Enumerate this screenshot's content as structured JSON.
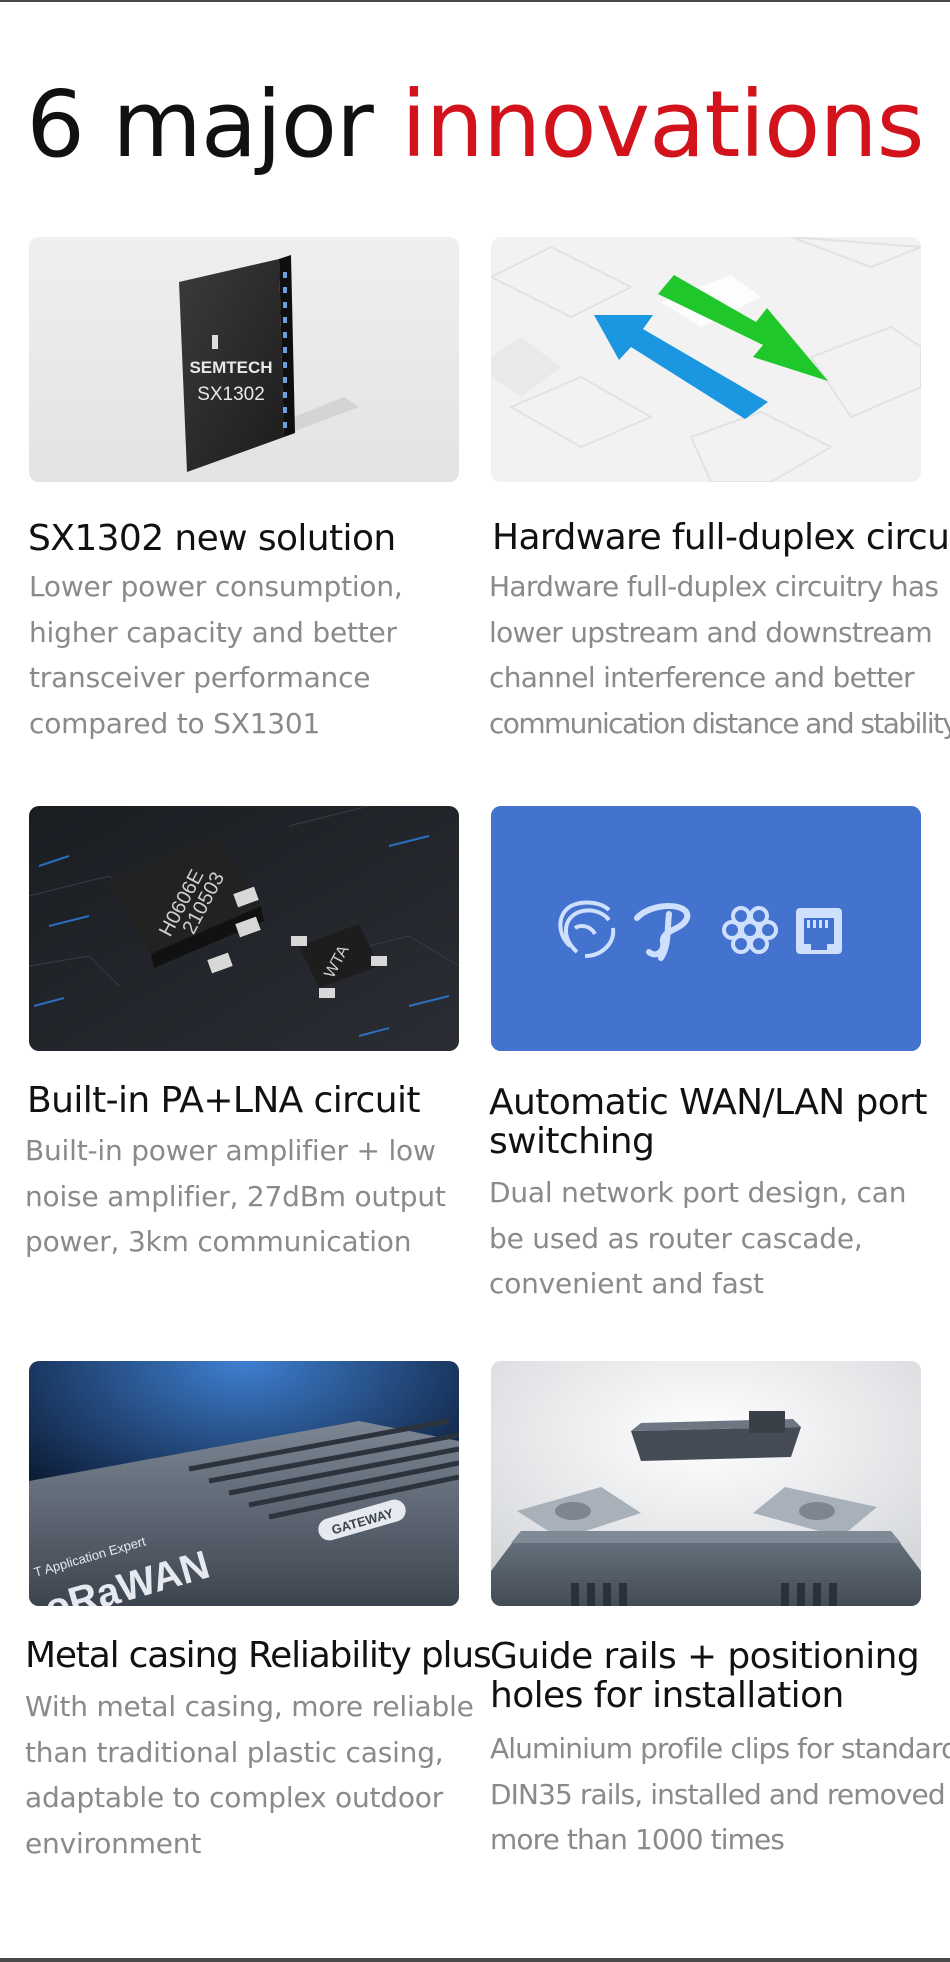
{
  "headline": {
    "part1": "6 major",
    "part2": "innovations"
  },
  "colors": {
    "accent": "#d2131c",
    "title": "#111111",
    "desc": "#8a8a8a",
    "carrier_bg": "#4472cf"
  },
  "features": [
    {
      "title": "SX1302 new solution",
      "desc": [
        "Lower power consumption,",
        "higher capacity and better",
        "transceiver performance",
        "compared to SX1301"
      ],
      "image": {
        "type": "chip-photo",
        "chip_text": [
          "SEMTECH",
          "SX1302"
        ]
      }
    },
    {
      "title": "Hardware full-duplex circuit",
      "desc": [
        "Hardware full-duplex circuitry has",
        "lower upstream and downstream",
        "channel interference and better",
        "communication distance and stability."
      ],
      "image": {
        "type": "duplex-arrows",
        "icons": [
          "arrow-up-left-icon",
          "arrow-down-right-icon"
        ]
      }
    },
    {
      "title": "Built-in PA+LNA circuit",
      "desc": [
        "Built-in power amplifier + low",
        "noise amplifier, 27dBm output",
        "power, 3km communication"
      ],
      "image": {
        "type": "pcb-photo",
        "chip_text": [
          "H0606E",
          "210503",
          "WTA"
        ]
      }
    },
    {
      "title": "Automatic WAN/LAN port switching",
      "desc": [
        "Dual network port design, can",
        "be used as router cascade,",
        "convenient and fast"
      ],
      "image": {
        "type": "carrier-icons",
        "icons": [
          "china-mobile-icon",
          "china-telecom-icon",
          "china-unicom-icon",
          "ethernet-port-icon"
        ]
      }
    },
    {
      "title": "Metal casing Reliability plus",
      "desc": [
        "With metal casing, more reliable",
        "than traditional plastic casing,",
        "adaptable to complex outdoor",
        "environment"
      ],
      "image": {
        "type": "casing-photo",
        "case_text": [
          "T Application Expert",
          "LoRaWAN",
          "GATEWAY"
        ]
      }
    },
    {
      "title": "Guide rails + positioning holes for installation",
      "desc": [
        "Aluminium profile clips for standard",
        "DIN35 rails, installed and removed",
        "more than 1000 times"
      ],
      "image": {
        "type": "din-rail-photo"
      }
    }
  ]
}
